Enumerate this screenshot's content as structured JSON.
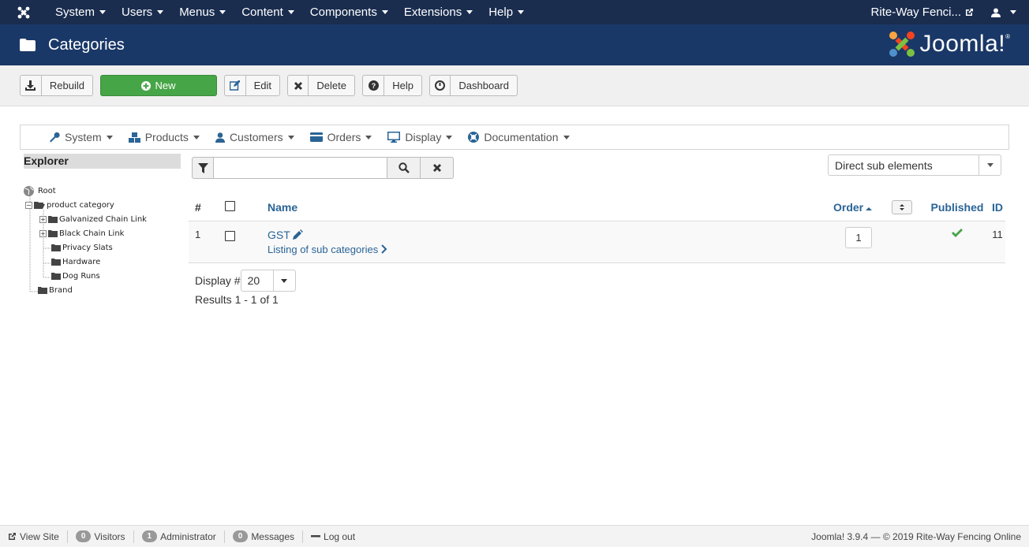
{
  "topbar": {
    "menu": [
      "System",
      "Users",
      "Menus",
      "Content",
      "Components",
      "Extensions",
      "Help"
    ],
    "site_name": "Rite-Way Fenci..."
  },
  "header": {
    "title": "Categories",
    "brand": "Joomla!",
    "brand_mark": "®"
  },
  "toolbar": {
    "rebuild": "Rebuild",
    "new": "New",
    "edit": "Edit",
    "delete": "Delete",
    "help": "Help",
    "dashboard": "Dashboard"
  },
  "subnav": [
    "System",
    "Products",
    "Customers",
    "Orders",
    "Display",
    "Documentation"
  ],
  "explorer": {
    "title": "Explorer",
    "root": "Root",
    "items": [
      "product category",
      "Galvanized Chain Link",
      "Black Chain Link",
      "Privacy Slats",
      "Hardware",
      "Dog Runs",
      "Brand"
    ]
  },
  "filter": {
    "search_value": "",
    "dropdown_value": "Direct sub elements"
  },
  "table": {
    "headers": {
      "num": "#",
      "name": "Name",
      "order": "Order",
      "published": "Published",
      "id": "ID"
    },
    "rows": [
      {
        "num": "1",
        "name": "GST",
        "sub_link": "Listing of sub categories",
        "order": "1",
        "id": "11"
      }
    ]
  },
  "pager": {
    "display_label": "Display #",
    "display_value": "20",
    "results": "Results 1 - 1 of 1"
  },
  "status": {
    "view_site": "View Site",
    "visitors_count": "0",
    "visitors": "Visitors",
    "admin_count": "1",
    "admin": "Administrator",
    "messages_count": "0",
    "messages": "Messages",
    "logout": "Log out",
    "copyright": "Joomla! 3.9.4  —  © 2019 Rite-Way Fencing Online"
  },
  "colors": {
    "topbar": "#1a2d4f",
    "header": "#1a3867",
    "new_button": "#46a546",
    "link": "#2a6496",
    "published_check": "#46a546"
  }
}
